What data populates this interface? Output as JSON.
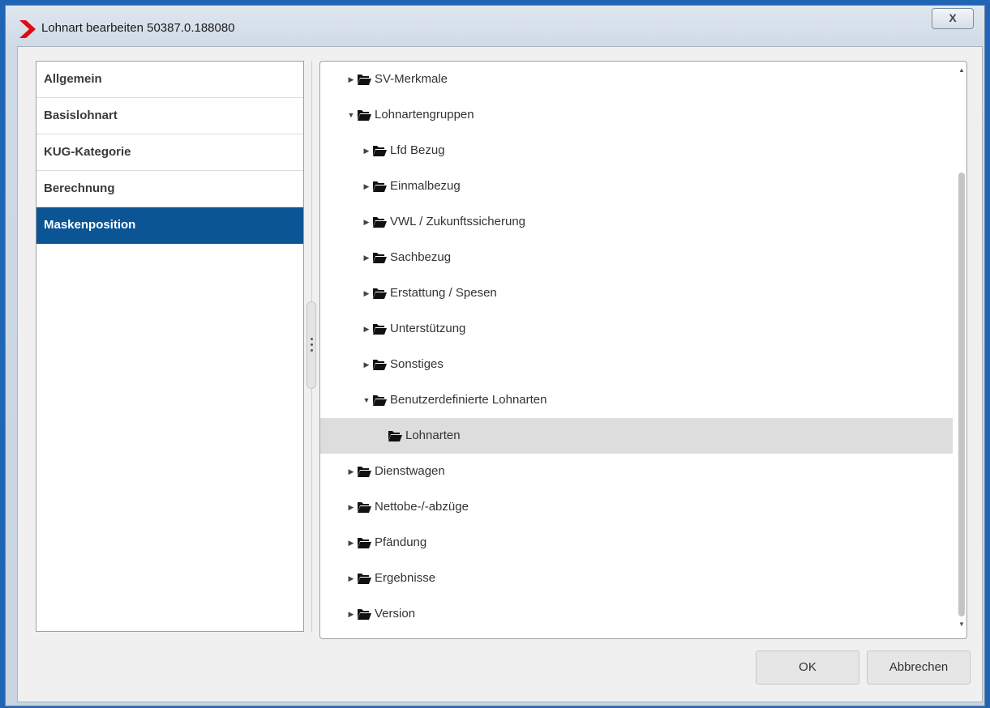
{
  "window": {
    "title": "Lohnart bearbeiten 50387.0.188080",
    "close_label": "X",
    "accent_color": "#0b5595",
    "logo_color": "#e30613"
  },
  "nav": {
    "items": [
      {
        "label": "Allgemein",
        "active": false
      },
      {
        "label": "Basislohnart",
        "active": false
      },
      {
        "label": "KUG-Kategorie",
        "active": false
      },
      {
        "label": "Berechnung",
        "active": false
      },
      {
        "label": "Maskenposition",
        "active": true
      }
    ]
  },
  "tree": {
    "items": [
      {
        "label": "SV-Merkmale",
        "level": 0,
        "expanded": false,
        "has_children": true,
        "selected": false
      },
      {
        "label": "Lohnartengruppen",
        "level": 0,
        "expanded": true,
        "has_children": true,
        "selected": false
      },
      {
        "label": "Lfd Bezug",
        "level": 1,
        "expanded": false,
        "has_children": true,
        "selected": false
      },
      {
        "label": "Einmalbezug",
        "level": 1,
        "expanded": false,
        "has_children": true,
        "selected": false
      },
      {
        "label": "VWL / Zukunftssicherung",
        "level": 1,
        "expanded": false,
        "has_children": true,
        "selected": false
      },
      {
        "label": "Sachbezug",
        "level": 1,
        "expanded": false,
        "has_children": true,
        "selected": false
      },
      {
        "label": "Erstattung / Spesen",
        "level": 1,
        "expanded": false,
        "has_children": true,
        "selected": false
      },
      {
        "label": "Unterstützung",
        "level": 1,
        "expanded": false,
        "has_children": true,
        "selected": false
      },
      {
        "label": "Sonstiges",
        "level": 1,
        "expanded": false,
        "has_children": true,
        "selected": false
      },
      {
        "label": "Benutzerdefinierte Lohnarten",
        "level": 1,
        "expanded": true,
        "has_children": true,
        "selected": false
      },
      {
        "label": "Lohnarten",
        "level": 2,
        "expanded": false,
        "has_children": false,
        "selected": true
      },
      {
        "label": "Dienstwagen",
        "level": 0,
        "expanded": false,
        "has_children": true,
        "selected": false
      },
      {
        "label": "Nettobe-/-abzüge",
        "level": 0,
        "expanded": false,
        "has_children": true,
        "selected": false
      },
      {
        "label": "Pfändung",
        "level": 0,
        "expanded": false,
        "has_children": true,
        "selected": false
      },
      {
        "label": "Ergebnisse",
        "level": 0,
        "expanded": false,
        "has_children": true,
        "selected": false
      },
      {
        "label": "Version",
        "level": 0,
        "expanded": false,
        "has_children": true,
        "selected": false
      }
    ]
  },
  "buttons": {
    "ok_label": "OK",
    "cancel_label": "Abbrechen"
  }
}
